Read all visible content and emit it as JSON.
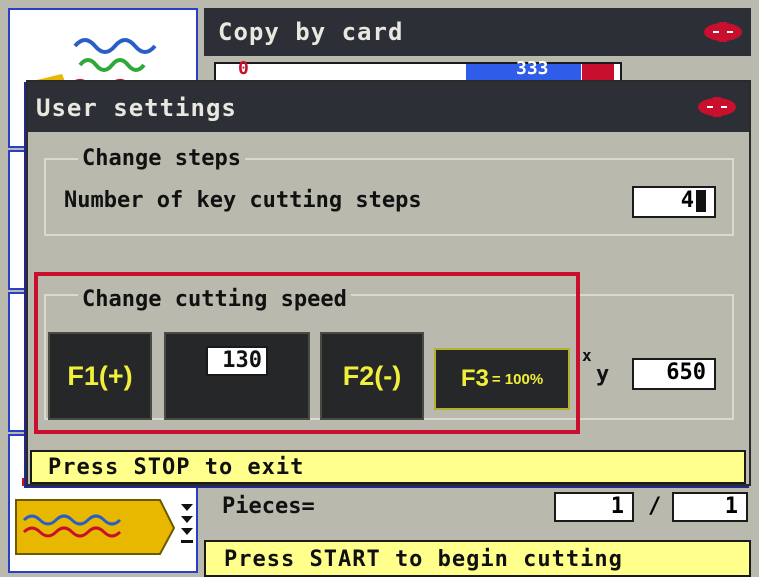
{
  "background_screen": {
    "title": "Copy by card",
    "top_field_left": "0",
    "top_field_value": "333",
    "pieces_label": "Pieces=",
    "pieces_current": "1",
    "pieces_separator": "/",
    "pieces_total": "1",
    "status_prompt": "Press START to begin cutting"
  },
  "dialog": {
    "title": "User settings",
    "group_steps": {
      "title": "Change steps",
      "label": "Number of key cutting steps",
      "value": "4"
    },
    "group_speed": {
      "title": "Change cutting speed",
      "f1_label": "F1(+)",
      "speed_value": "130",
      "f2_label": "F2(-)",
      "f3_label_main": "F3",
      "f3_label_sub": "= 100%",
      "axis_x": "x",
      "axis_y": "y",
      "xy_value": "650"
    },
    "footer": "Press STOP to exit"
  },
  "colors": {
    "title_bar": "#2c2f36",
    "dialog_bg": "#b9b9ae",
    "status_bar": "#ffff8c",
    "highlight_border": "#c8102e",
    "fkey_text": "#f2ef3a",
    "brand": "#c8102e"
  },
  "icons": [
    "silca-logo-icon",
    "key-profile-icon",
    "key-wave-icon",
    "step-arrows-icon",
    "warning-icon"
  ]
}
